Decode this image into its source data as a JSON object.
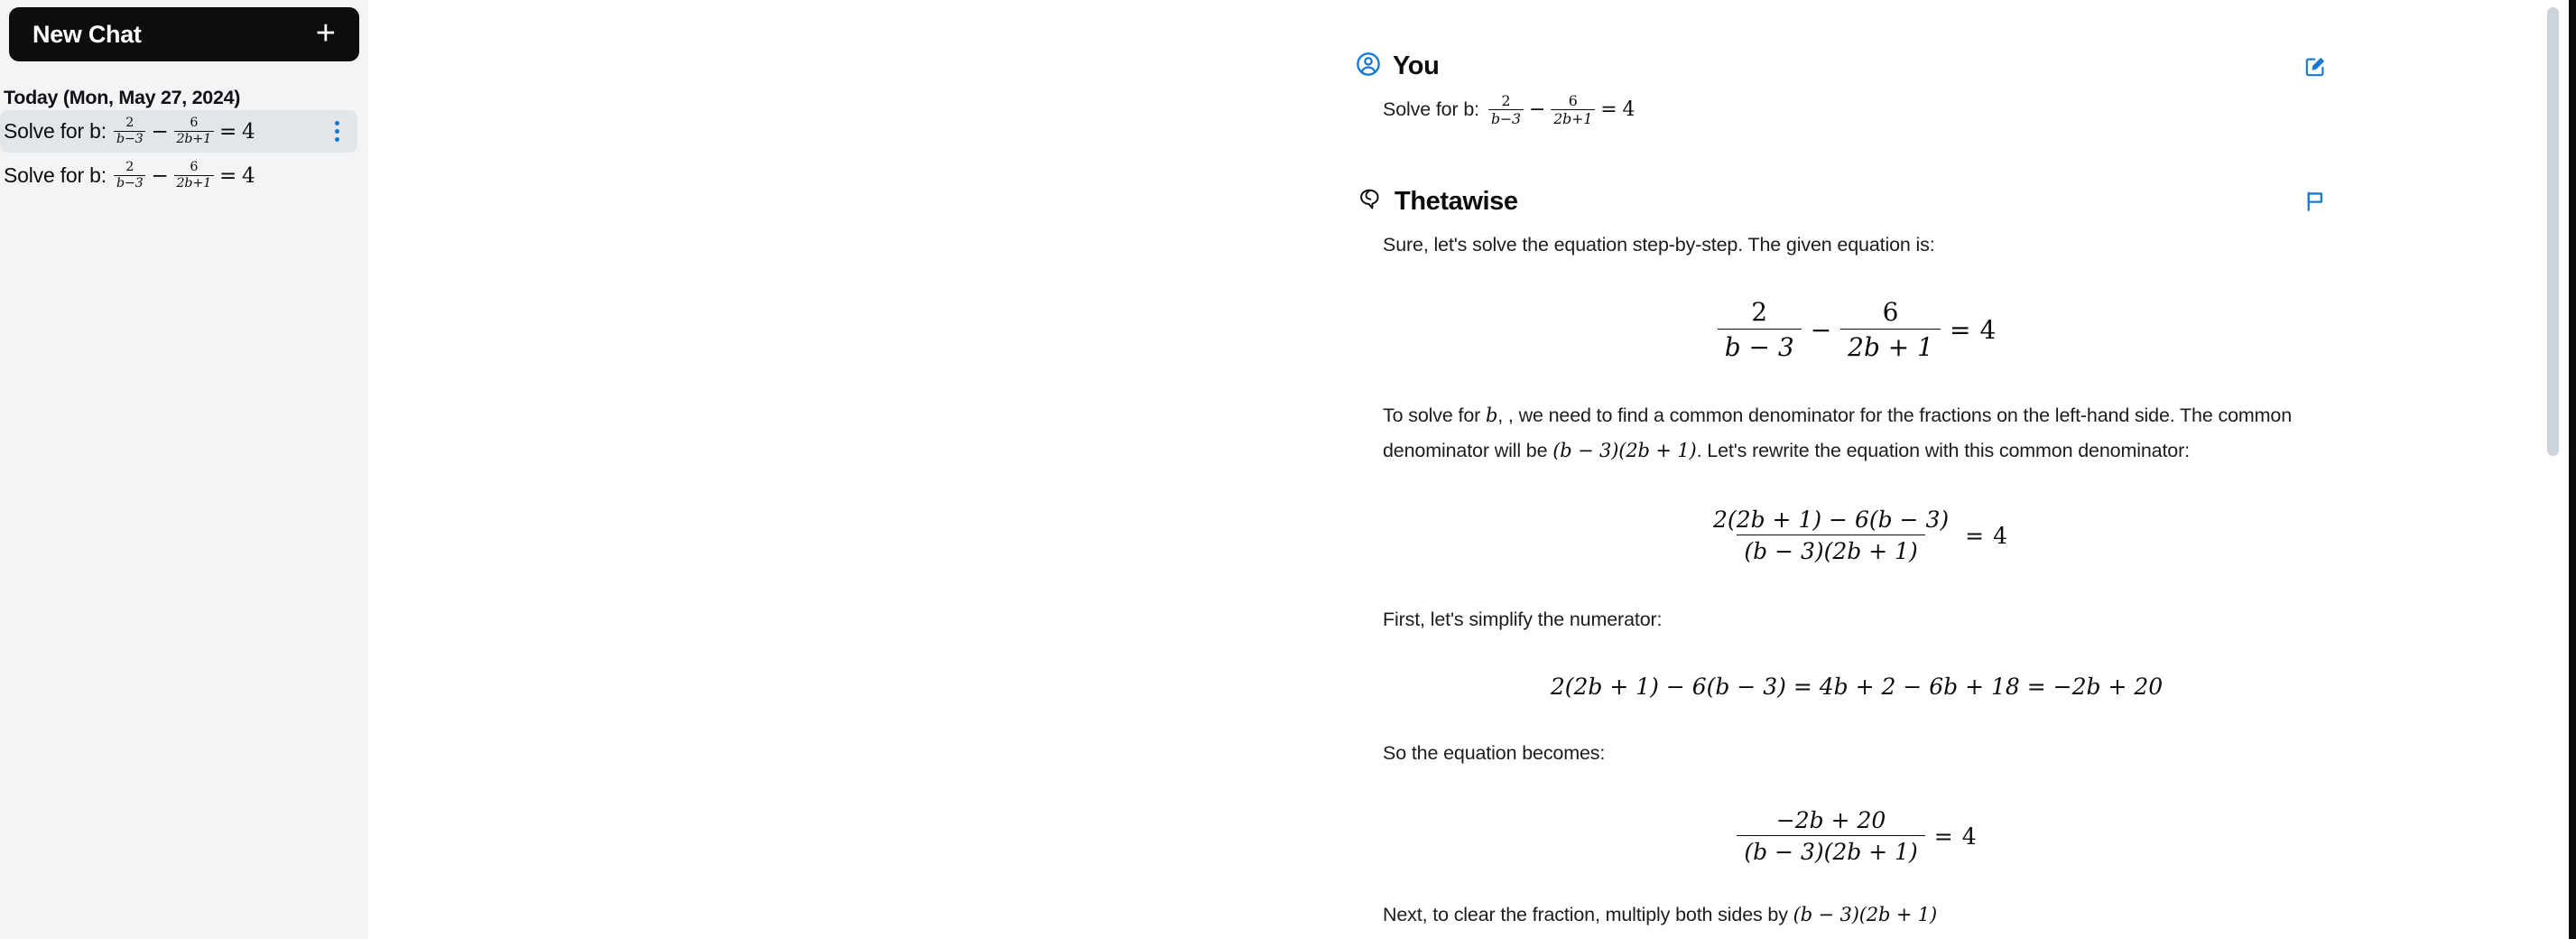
{
  "sidebar": {
    "new_chat_label": "New Chat",
    "new_chat_plus": "+",
    "today_label": "Today (Mon, May 27, 2024)",
    "items": [
      {
        "prefix": "Solve for b:",
        "selected": true
      },
      {
        "prefix": "Solve for b:",
        "selected": false
      }
    ],
    "collapse_icon": "chevron-left-icon"
  },
  "conversation": {
    "user": {
      "name": "You",
      "avatar_icon": "user-circle-icon",
      "action_icon": "edit-square-icon",
      "message_prefix": "Solve for b:"
    },
    "assistant": {
      "name": "Thetawise",
      "avatar_icon": "thetawise-logo-icon",
      "action_icon": "flag-icon",
      "paragraphs": {
        "p1": "Sure, let's solve the equation step-by-step. The given equation is:",
        "p2_a": "To solve for",
        "p2_b": ", we need to find a common denominator for the fractions on the left-hand side. The common denominator will be",
        "p2_c": ". Let's rewrite the equation with this common denominator:",
        "p3": "First, let's simplify the numerator:",
        "p4": "So the equation becomes:",
        "p5_a": "Next, to clear the fraction, multiply both sides by"
      }
    }
  },
  "math": {
    "two": "2",
    "six": "6",
    "four": "4",
    "b_minus_3": "b − 3",
    "b_minus_3_tight": "b−3",
    "two_b_plus_1": "2b + 1",
    "two_b_plus_1_tight": "2b+1",
    "minus": "−",
    "equals": "=",
    "numerator_expanded": "2(2b + 1) − 6(b − 3)",
    "denominator_product": "(b − 3)(2b + 1)",
    "simplify_line": "2(2b + 1) − 6(b − 3) = 4b + 2 − 6b + 18 = −2b + 20",
    "neg_2b_plus_20": "−2b + 20",
    "b_var": "b"
  },
  "colors": {
    "accent_blue": "#1878d2",
    "sidebar_bg": "#f2f4f6",
    "selected_row": "#e2e6ea",
    "button_black": "#0d0d0d",
    "scrollbar": "#ccd3d9"
  }
}
